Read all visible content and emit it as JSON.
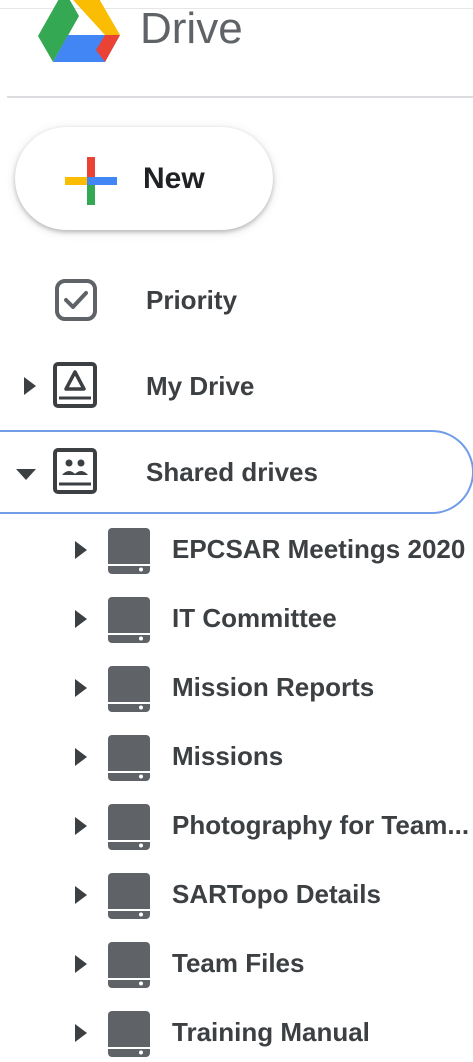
{
  "app": {
    "brand": "Drive",
    "logo_icon": "google-drive-logo-icon"
  },
  "new_button": {
    "label": "New",
    "icon": "plus-icon"
  },
  "nav": [
    {
      "label": "Priority",
      "icon": "priority-checkbox-icon",
      "caret": "none"
    },
    {
      "label": "My Drive",
      "icon": "my-drive-icon",
      "caret": "right"
    },
    {
      "label": "Shared drives",
      "icon": "shared-drives-icon",
      "caret": "down",
      "selected": true
    }
  ],
  "shared_drives": [
    {
      "label": "EPCSAR Meetings 2020"
    },
    {
      "label": "IT Committee"
    },
    {
      "label": "Mission Reports"
    },
    {
      "label": "Missions"
    },
    {
      "label": "Photography for Team..."
    },
    {
      "label": "SARTopo Details"
    },
    {
      "label": "Team Files"
    },
    {
      "label": "Training Manual"
    }
  ],
  "colors": {
    "selection_border": "#6f9de8",
    "icon_gray": "#5f6368",
    "text": "#3c4043",
    "plus_red": "#ea4335",
    "plus_blue": "#4285f4",
    "plus_green": "#34a853",
    "plus_yellow": "#fbbc04"
  }
}
